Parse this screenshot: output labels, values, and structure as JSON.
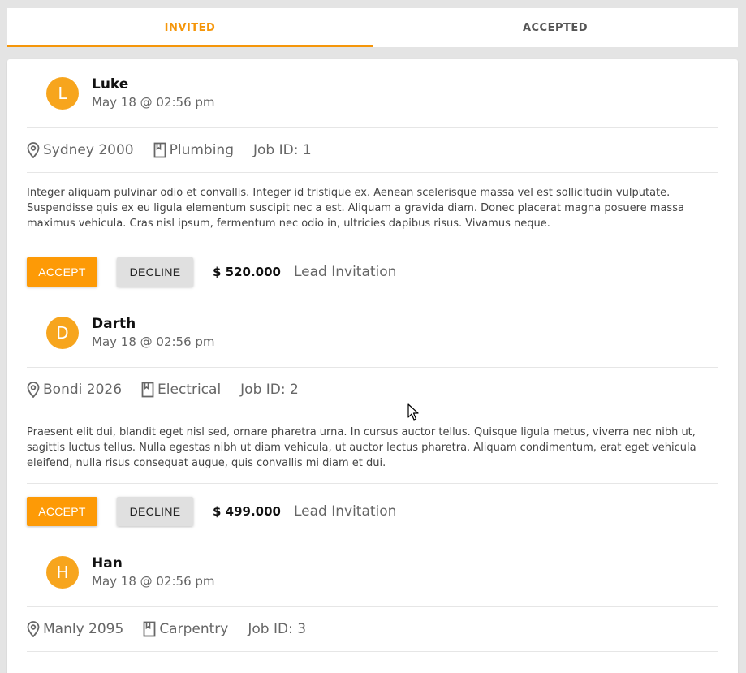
{
  "tabs": [
    {
      "label": "INVITED",
      "active": true
    },
    {
      "label": "ACCEPTED",
      "active": false
    }
  ],
  "leads": [
    {
      "initial": "L",
      "name": "Luke",
      "date": "May 18 @ 02:56 pm",
      "location": "Sydney 2000",
      "category": "Plumbing",
      "job_id": "Job ID: 1",
      "description": "Integer aliquam pulvinar odio et convallis. Integer id tristique ex. Aenean scelerisque massa vel est sollicitudin vulputate. Suspendisse quis ex eu ligula elementum suscipit nec a est. Aliquam a gravida diam. Donec placerat magna posuere massa maximus vehicula. Cras nisl ipsum, fermentum nec odio in, ultricies dapibus risus. Vivamus neque.",
      "accept_label": "ACCEPT",
      "decline_label": "DECLINE",
      "price": "$ 520.000",
      "status": "Lead Invitation"
    },
    {
      "initial": "D",
      "name": "Darth",
      "date": "May 18 @ 02:56 pm",
      "location": "Bondi 2026",
      "category": "Electrical",
      "job_id": "Job ID: 2",
      "description": "Praesent elit dui, blandit eget nisl sed, ornare pharetra urna. In cursus auctor tellus. Quisque ligula metus, viverra nec nibh ut, sagittis luctus tellus. Nulla egestas nibh ut diam vehicula, ut auctor lectus pharetra. Aliquam condimentum, erat eget vehicula eleifend, nulla risus consequat augue, quis convallis mi diam et dui.",
      "accept_label": "ACCEPT",
      "decline_label": "DECLINE",
      "price": "$ 499.000",
      "status": "Lead Invitation"
    },
    {
      "initial": "H",
      "name": "Han",
      "date": "May 18 @ 02:56 pm",
      "location": "Manly 2095",
      "category": "Carpentry",
      "job_id": "Job ID: 3"
    }
  ],
  "colors": {
    "accent": "#f5960a",
    "avatar": "#f7a51d",
    "accept": "#fd9a06"
  }
}
